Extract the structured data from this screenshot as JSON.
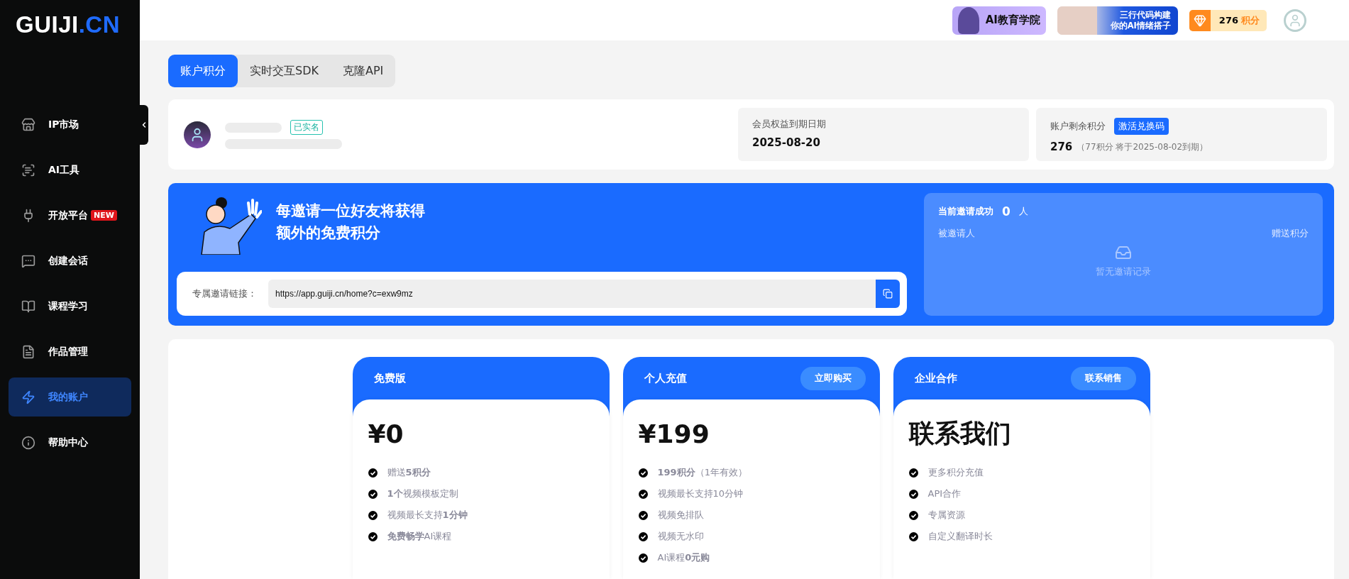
{
  "logo": {
    "text": "GUIJI",
    "suffix": ".CN"
  },
  "sidebar": {
    "items": [
      {
        "label": "IP市场",
        "selected": false
      },
      {
        "label": "AI工具",
        "selected": false
      },
      {
        "label": "开放平台",
        "selected": false,
        "badge": "NEW"
      },
      {
        "label": "创建会话",
        "selected": false
      },
      {
        "label": "课程学习",
        "selected": false
      },
      {
        "label": "作品管理",
        "selected": false
      },
      {
        "label": "我的账户",
        "selected": true
      },
      {
        "label": "帮助中心",
        "selected": false
      }
    ]
  },
  "topbar": {
    "academy_banner": "AI教育学院",
    "promo_banner": [
      "三行代码构建",
      "你的AI情绪搭子"
    ],
    "points": "276",
    "points_unit": "积分"
  },
  "tabs": [
    {
      "label": "账户积分",
      "selected": true
    },
    {
      "label": "实时交互SDK",
      "selected": false
    },
    {
      "label": "克隆API",
      "selected": false
    }
  ],
  "profile": {
    "verified": "已实名",
    "expiry_label": "会员权益到期日期",
    "expiry_value": "2025-08-20",
    "points_label": "账户剩余积分",
    "redeem_button": "激活兑换码",
    "points_value": "276",
    "points_note": "（77积分 将于2025-08-02到期）"
  },
  "invite": {
    "headline": [
      "每邀请一位好友将获得",
      "额外的免费积分"
    ],
    "link_label": "专属邀请链接：",
    "link_value": "https://app.guiji.cn/home?c=exw9mz",
    "success_label": "当前邀请成功",
    "success_count": "0",
    "success_unit": "人",
    "col_invitee": "被邀请人",
    "col_points": "赠送积分",
    "empty": "暂无邀请记录"
  },
  "plans": [
    {
      "title": "免费版",
      "price": "¥0",
      "features": [
        "赠送**5积分**",
        "**1个**视频模板定制",
        "视频最长支持**1分钟**",
        "**免费畅学**AI课程"
      ]
    },
    {
      "title": "个人充值",
      "button": "立即购买",
      "price": "¥199",
      "features": [
        "**199积分**（1年有效）",
        "视频最长支持10分钟",
        "视频免排队",
        "视频无水印",
        "AI课程**0元购**"
      ]
    },
    {
      "title": "企业合作",
      "button": "联系销售",
      "price": "联系我们",
      "features": [
        "更多积分充值",
        "API合作",
        "专属资源",
        "自定义翻译时长"
      ]
    }
  ]
}
